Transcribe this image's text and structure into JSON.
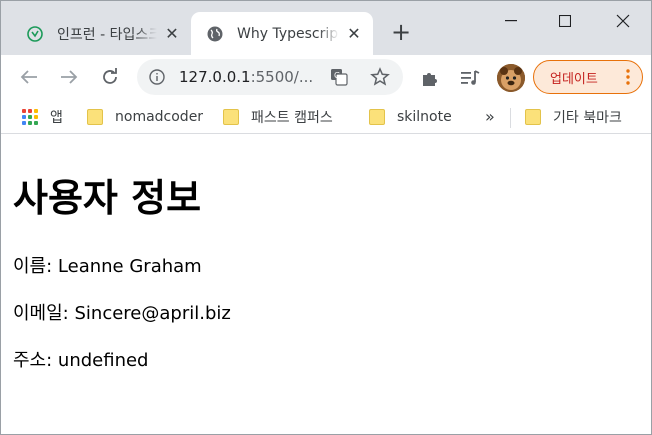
{
  "tabs": [
    {
      "title": "인프런 - 타입스크립트",
      "favicon": "inflearn-icon",
      "active": false
    },
    {
      "title": "Why Typescript",
      "favicon": "globe-icon",
      "active": true
    }
  ],
  "omnibox": {
    "host": "127.0.0.1",
    "path": ":5500/..."
  },
  "update_button": {
    "label": "업데이트"
  },
  "bookmarks": [
    {
      "label": "앱",
      "icon": "apps-icon"
    },
    {
      "label": "nomadcoder",
      "icon": "folder-icon"
    },
    {
      "label": "패스트 캠퍼스",
      "icon": "folder-icon"
    },
    {
      "label": "skilnote",
      "icon": "folder-icon"
    },
    {
      "label": "기타 북마크",
      "icon": "folder-icon"
    }
  ],
  "page": {
    "heading": "사용자 정보",
    "name_label": "이름:",
    "name_value": "Leanne Graham",
    "email_label": "이메일:",
    "email_value": "Sincere@april.biz",
    "address_label": "주소:",
    "address_value": "undefined"
  }
}
